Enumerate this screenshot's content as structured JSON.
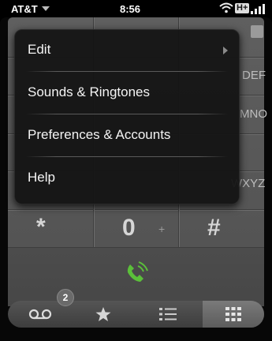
{
  "status_bar": {
    "carrier": "AT&T",
    "time": "8:56",
    "network": "H+"
  },
  "keypad": {
    "partial_letters": [
      "DEF",
      "MNO",
      "WXYZ"
    ],
    "bottom_row": {
      "star": "*",
      "zero": "0",
      "plus": "+",
      "hash": "#"
    }
  },
  "menu": {
    "items": [
      {
        "label": "Edit"
      },
      {
        "label": "Sounds & Ringtones"
      },
      {
        "label": "Preferences & Accounts"
      },
      {
        "label": "Help"
      }
    ]
  },
  "tabs": {
    "voicemail_badge": "2"
  },
  "icons": {
    "call": "phone-call-icon",
    "voicemail": "voicemail-icon",
    "favorites": "star-icon",
    "call_log": "list-icon",
    "dialpad": "dialpad-icon"
  },
  "colors": {
    "call_icon": "#5bbf3a",
    "menu_bg": "#141414"
  }
}
